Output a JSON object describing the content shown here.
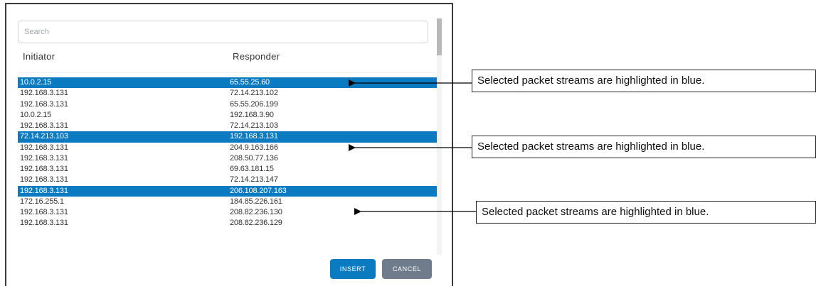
{
  "search": {
    "placeholder": "Search"
  },
  "columns": {
    "initiator": "Initiator",
    "responder": "Responder"
  },
  "rows": [
    {
      "initiator": "10.0.2.15",
      "responder": "65.55.25.60",
      "selected": true
    },
    {
      "initiator": "192.168.3.131",
      "responder": "72.14.213.102",
      "selected": false
    },
    {
      "initiator": "192.168.3.131",
      "responder": "65.55.206.199",
      "selected": false
    },
    {
      "initiator": "10.0.2.15",
      "responder": "192.168.3.90",
      "selected": false
    },
    {
      "initiator": "192.168.3.131",
      "responder": "72.14.213.103",
      "selected": false
    },
    {
      "initiator": "72.14.213.103",
      "responder": "192.168.3.131",
      "selected": true
    },
    {
      "initiator": "192.168.3.131",
      "responder": "204.9.163.166",
      "selected": false
    },
    {
      "initiator": "192.168.3.131",
      "responder": "208.50.77.136",
      "selected": false
    },
    {
      "initiator": "192.168.3.131",
      "responder": "69.63.181.15",
      "selected": false
    },
    {
      "initiator": "192.168.3.131",
      "responder": "72.14.213.147",
      "selected": false
    },
    {
      "initiator": "192.168.3.131",
      "responder": "206.108.207.163",
      "selected": true
    },
    {
      "initiator": "172.16.255.1",
      "responder": "184.85.226.161",
      "selected": false
    },
    {
      "initiator": "192.168.3.131",
      "responder": "208.82.236.130",
      "selected": false
    },
    {
      "initiator": "192.168.3.131",
      "responder": "208.82.236.129",
      "selected": false
    }
  ],
  "buttons": {
    "insert": "INSERT",
    "cancel": "CANCEL"
  },
  "callouts": [
    "Selected packet streams are highlighted in blue.",
    "Selected packet streams are highlighted in blue.",
    "Selected packet streams are highlighted in blue."
  ],
  "colors": {
    "selection": "#0a7ac1",
    "insert_button": "#0a7ac1",
    "cancel_button": "#6f7c8c"
  }
}
